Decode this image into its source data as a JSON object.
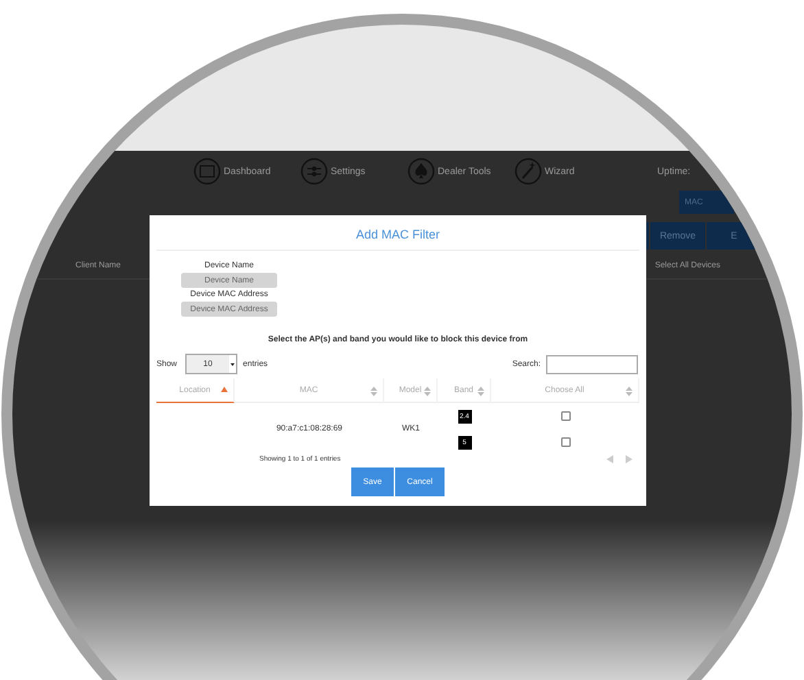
{
  "nav": [
    {
      "label": "Dashboard"
    },
    {
      "label": "Settings"
    },
    {
      "label": "Dealer Tools"
    },
    {
      "label": "Wizard"
    }
  ],
  "uptime_label": "Uptime:",
  "mac_button": "MAC",
  "toolbar_buttons": [
    "Remove",
    "E"
  ],
  "client_columns": [
    "Client Name",
    "Select All Devices"
  ],
  "dialog": {
    "title": "Add MAC Filter",
    "fields": [
      {
        "label": "Device Name",
        "placeholder": "Device Name"
      },
      {
        "label": "Device MAC Address",
        "placeholder": "Device MAC Address"
      }
    ],
    "prompt": "Select the AP(s) and band you would like to block this device from",
    "show_label": "Show",
    "page_size": "10",
    "entries_label": "entries",
    "search_label": "Search:",
    "columns": [
      {
        "label": "Location",
        "sorted": true
      },
      {
        "label": "MAC",
        "sorted": false
      },
      {
        "label": "Model",
        "sorted": false
      },
      {
        "label": "Band",
        "sorted": false
      },
      {
        "label": "Choose All",
        "sorted": false
      }
    ],
    "rows": [
      {
        "mac": "90:a7:c1:08:28:69",
        "model": "WK1",
        "bands": [
          {
            "label": "2.4",
            "checked": false
          },
          {
            "label": "5",
            "checked": false
          }
        ]
      }
    ],
    "info": "Showing 1 to 1 of 1 entries",
    "buttons": [
      "Save",
      "Cancel"
    ]
  }
}
